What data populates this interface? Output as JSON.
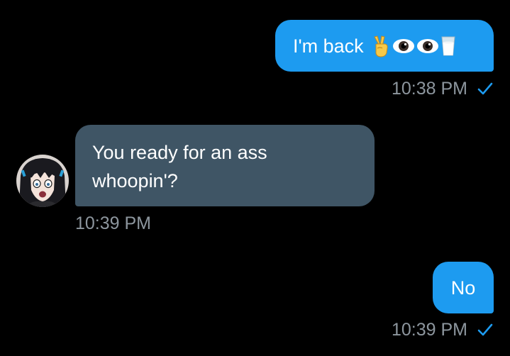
{
  "messages": [
    {
      "id": "msg1",
      "direction": "outgoing",
      "text": "I'm back",
      "emoji_icons": [
        "victory-hand-icon",
        "eye-icon",
        "eye-icon",
        "glass-of-milk-icon"
      ],
      "time": "10:38 PM",
      "status": "sent-check-icon"
    },
    {
      "id": "msg2",
      "direction": "incoming",
      "lines": [
        "You ready for an ass",
        "whoopin'?"
      ],
      "time": "10:39 PM",
      "avatar": "avatar-anime-girl-icon"
    },
    {
      "id": "msg3",
      "direction": "outgoing",
      "text": "No",
      "time": "10:39 PM",
      "status": "sent-check-icon"
    }
  ],
  "colors": {
    "background": "#000000",
    "outgoing_bubble": "#1d9bf0",
    "incoming_bubble": "#3f5565",
    "timestamp": "#8d969e",
    "check": "#1d9bf0"
  }
}
